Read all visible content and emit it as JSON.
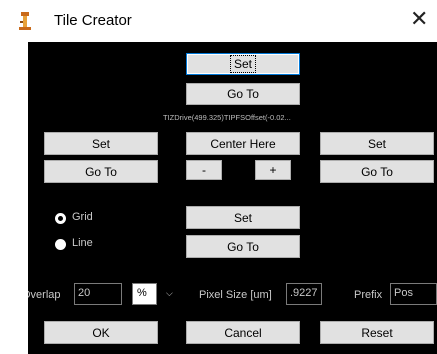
{
  "window": {
    "title": "Tile Creator",
    "close_glyph": "✕"
  },
  "top": {
    "set": "Set",
    "goto": "Go To"
  },
  "status_text": "TIZDrive(499.325)TIPFSOffset(-0.02...",
  "left": {
    "set": "Set",
    "goto": "Go To"
  },
  "center": {
    "center_here": "Center Here",
    "minus": "-",
    "plus": "+"
  },
  "right": {
    "set": "Set",
    "goto": "Go To"
  },
  "mode": {
    "grid": "Grid",
    "line": "Line",
    "selected": "Grid"
  },
  "middle": {
    "set": "Set",
    "goto": "Go To"
  },
  "overlap": {
    "label": "Overlap",
    "value": "20",
    "unit_selected": "%"
  },
  "pixel_size": {
    "label": "Pixel Size [um]",
    "value": ".9227"
  },
  "prefix": {
    "label": "Prefix",
    "value": "Pos"
  },
  "footer": {
    "ok": "OK",
    "cancel": "Cancel",
    "reset": "Reset"
  },
  "colors": {
    "panel_bg": "#000000",
    "button_bg": "#e1e1e1",
    "focus_border": "#0078d7",
    "label_text": "#c9c9c9"
  },
  "icons": {
    "app": "tile-creator-app-icon",
    "close": "close-icon",
    "dropdown": "chevron-down-icon"
  }
}
